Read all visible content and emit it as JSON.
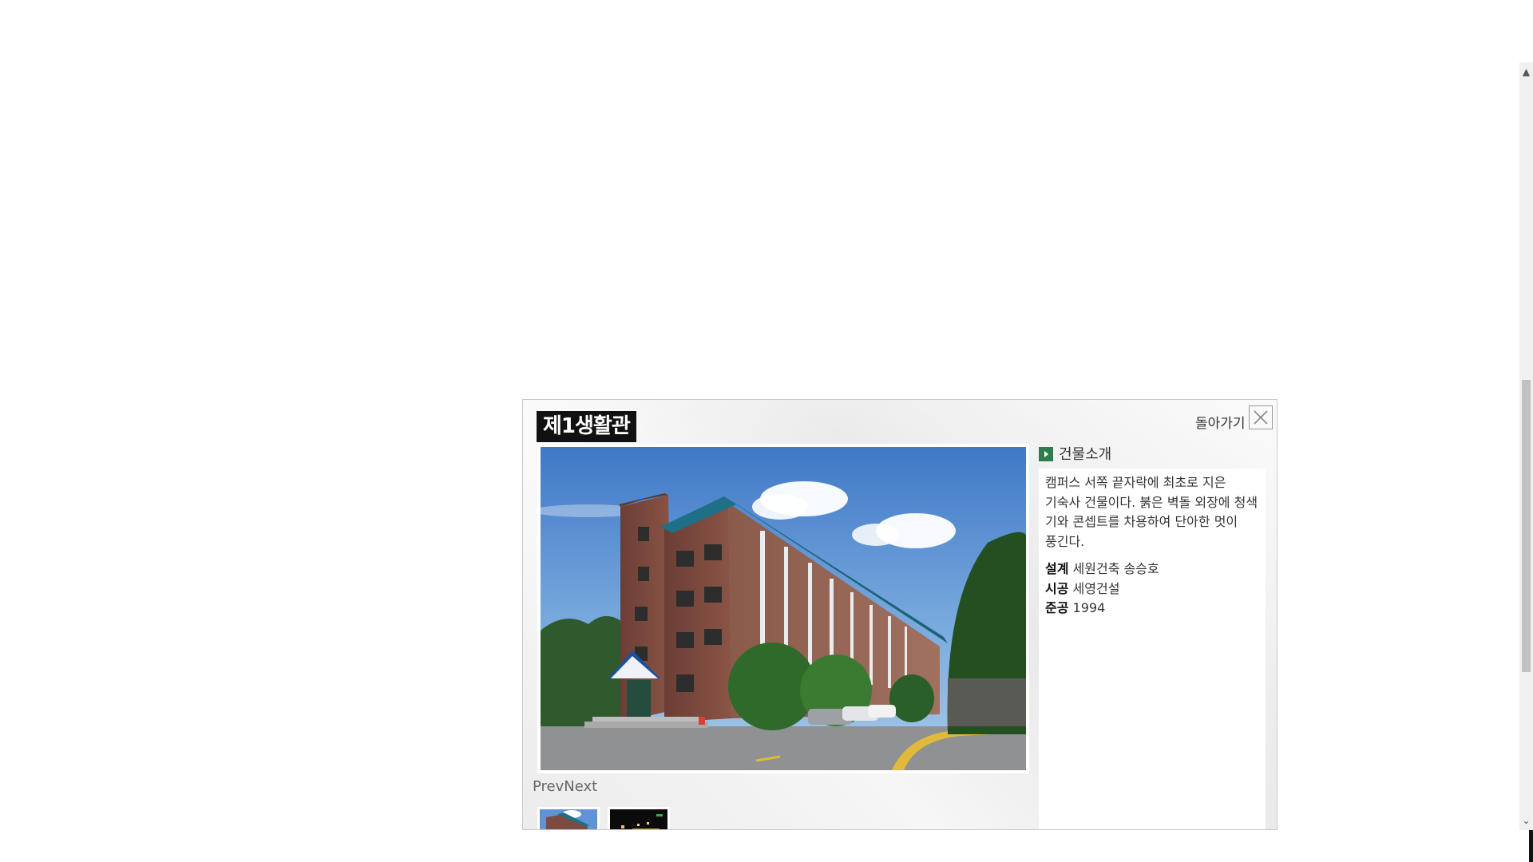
{
  "modal": {
    "title": "제1생활관",
    "back_label": "돌아가기",
    "close_icon": "close-icon",
    "prev_label": "Prev",
    "next_label": "Next",
    "thumbnails": [
      {
        "name": "thumbnail-day"
      },
      {
        "name": "thumbnail-night"
      }
    ]
  },
  "info": {
    "heading": "건물소개",
    "description": "캠퍼스 서쪽 끝자락에 최초로 지은 기숙사 건물이다. 붉은 벽돌 외장에 청색 기와 콘셉트를 차용하여 단아한 멋이 풍긴다.",
    "design_label": "설계",
    "design_value": "세원건축 송승호",
    "construction_label": "시공",
    "construction_value": "세영건설",
    "completion_label": "준공",
    "completion_value": "1994"
  },
  "colors": {
    "title_bg": "#111111",
    "heading_icon": "#2e7d4f",
    "sky": "#5b8fd1",
    "brick": "#7d4b3f",
    "roof": "#1f6f86"
  }
}
